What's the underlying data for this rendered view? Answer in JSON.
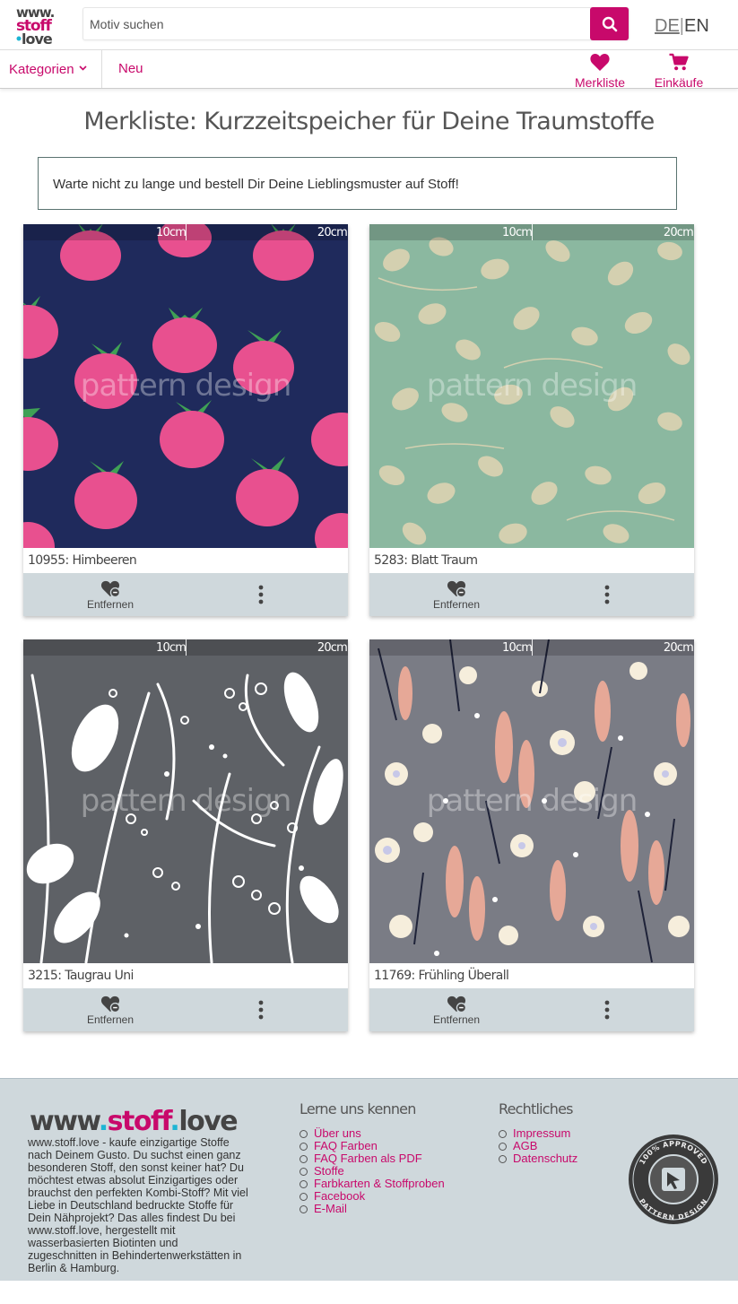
{
  "header": {
    "logo_lines": [
      "www.",
      "stoff",
      ".love"
    ],
    "search_placeholder": "Motiv suchen",
    "lang_de": "DE",
    "lang_sep": "|",
    "lang_en": "EN"
  },
  "nav": {
    "categories": "Kategorien",
    "new": "Neu",
    "wishlist": "Merkliste",
    "purchases": "Einkäufe"
  },
  "page": {
    "title": "Merkliste: Kurzzeitspeicher für Deine Traumstoffe",
    "notice": "Warte nicht zu lange und bestell Dir Deine Lieblingsmuster auf Stoff!"
  },
  "card_common": {
    "ruler_10": "10cm",
    "ruler_20": "20cm",
    "watermark": "pattern design",
    "remove_label": "Entfernen"
  },
  "cards": [
    {
      "title": "10955: Himbeeren",
      "bg": "#1f2a5c",
      "accent": "#e8508f",
      "accent2": "#3fa155"
    },
    {
      "title": "5283: Blatt Traum",
      "bg": "#8bb8a0",
      "accent": "#d4d0b0",
      "accent2": "#c9c6a6"
    },
    {
      "title": "3215: Taugrau Uni",
      "bg": "#5e6166",
      "accent": "#ffffff",
      "accent2": "#e6e6e6"
    },
    {
      "title": "11769: Frühling Überall",
      "bg": "#7a7c85",
      "accent": "#e6a897",
      "accent2": "#f6eedc"
    }
  ],
  "footer": {
    "logo_www": "www",
    "logo_dot1": ".",
    "logo_stoff": "stoff",
    "logo_dot2": ".",
    "logo_love": "love",
    "about": "www.stoff.love - kaufe einzigartige Stoffe nach Deinem Gusto. Du suchst einen ganz besonderen Stoff, den sonst keiner hat? Du möchtest etwas absolut Einzigartiges oder brauchst den perfekten Kombi-Stoff? Mit viel Liebe in Deutschland bedruckte Stoffe für Dein Nähprojekt? Das alles findest Du bei www.stoff.love, hergestellt mit wasserbasierten Biotinten und zugeschnitten in Behindertenwerkstätten in Berlin & Hamburg.",
    "col1_title": "Lerne uns kennen",
    "col1_links": [
      "Über uns",
      "FAQ Farben",
      "FAQ Farben als PDF",
      "Stoffe",
      "Farbkarten & Stoffproben",
      "Facebook",
      "E-Mail"
    ],
    "col2_title": "Rechtliches",
    "col2_links": [
      "Impressum",
      "AGB",
      "Datenschutz"
    ],
    "badge_top": "100% APPROVED",
    "badge_bottom": "PATTERN DESIGN"
  },
  "colors": {
    "brand": "#c8096b",
    "action_bar": "#cfd8dc",
    "footer_bg": "#cfd8dc"
  }
}
